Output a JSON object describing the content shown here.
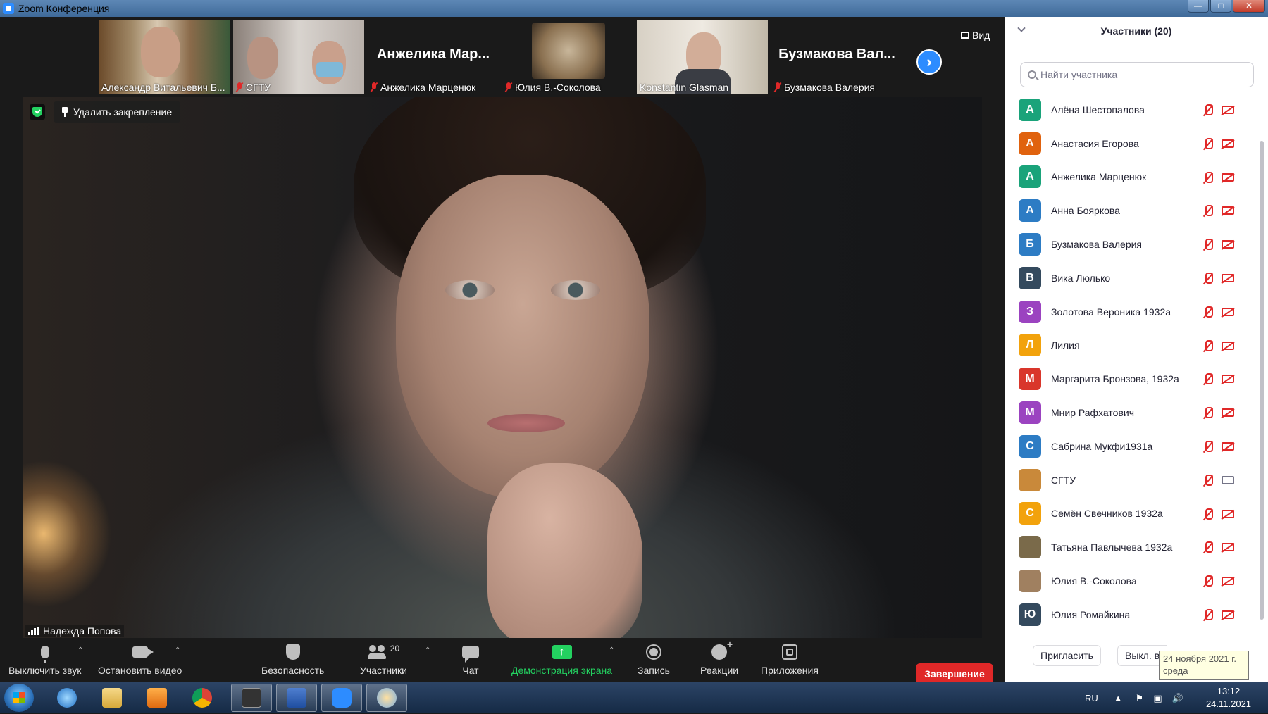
{
  "window": {
    "title": "Zoom Конференция"
  },
  "thumbnails": [
    {
      "name": "Александр Витальевич Б...",
      "muted": false
    },
    {
      "name": "СГТУ",
      "muted": true
    },
    {
      "big_name": "Анжелика Мар...",
      "name": "Анжелика Марценюк",
      "muted": true
    },
    {
      "name": "Юлия В.-Соколова",
      "muted": true
    },
    {
      "name": "Konstantin Glasman",
      "muted": false
    },
    {
      "big_name": "Бузмакова Вал...",
      "name": "Бузмакова Валерия",
      "muted": true
    }
  ],
  "view_label": "Вид",
  "main_video": {
    "unpin_label": "Удалить закрепление",
    "speaker_name": "Надежда Попова"
  },
  "toolbar": {
    "mute_label": "Выключить звук",
    "video_label": "Остановить видео",
    "security_label": "Безопасность",
    "participants_label": "Участники",
    "participants_count": "20",
    "chat_label": "Чат",
    "share_label": "Демонстрация экрана",
    "record_label": "Запись",
    "reactions_label": "Реакции",
    "apps_label": "Приложения",
    "end_label": "Завершение"
  },
  "panel": {
    "title": "Участники (20)",
    "search_placeholder": "Найти участника",
    "participants": [
      {
        "initial": "А",
        "name": "Алёна Шестопалова",
        "color": "#1aa37a",
        "video_on": false
      },
      {
        "initial": "А",
        "name": "Анастасия Егорова",
        "color": "#e0620e",
        "video_on": false
      },
      {
        "initial": "А",
        "name": "Анжелика Марценюк",
        "color": "#1aa37a",
        "video_on": false
      },
      {
        "initial": "А",
        "name": "Анна Бояркова",
        "color": "#2d7cc4",
        "video_on": false
      },
      {
        "initial": "Б",
        "name": "Бузмакова Валерия",
        "color": "#2d7cc4",
        "video_on": false
      },
      {
        "initial": "В",
        "name": "Вика Люлько",
        "color": "#344a5e",
        "video_on": false
      },
      {
        "initial": "З",
        "name": "Золотова Вероника 1932а",
        "color": "#9b43c0",
        "video_on": false
      },
      {
        "initial": "Л",
        "name": "Лилия",
        "color": "#f2a20c",
        "video_on": false
      },
      {
        "initial": "М",
        "name": "Маргарита Бронзова, 1932а",
        "color": "#d9362b",
        "video_on": false
      },
      {
        "initial": "М",
        "name": "Мнир Рафхатович",
        "color": "#9b43c0",
        "video_on": false
      },
      {
        "initial": "С",
        "name": "Сабрина Мукфи1931а",
        "color": "#2d7cc4",
        "video_on": false
      },
      {
        "initial": "",
        "name": "СГТУ",
        "color": "#c9893a",
        "video_on": true
      },
      {
        "initial": "С",
        "name": "Семён Свечников 1932а",
        "color": "#f2a20c",
        "video_on": false
      },
      {
        "initial": "",
        "name": "Татьяна Павлычева 1932а",
        "color": "#7a6a4a",
        "video_on": false
      },
      {
        "initial": "",
        "name": "Юлия В.-Соколова",
        "color": "#a08060",
        "video_on": false
      },
      {
        "initial": "Ю",
        "name": "Юлия Ромайкина",
        "color": "#344a5e",
        "video_on": false
      }
    ],
    "invite_label": "Пригласить",
    "mute_all_label": "Выкл. в"
  },
  "tooltip": {
    "line1": "24 ноября 2021 г.",
    "line2": "среда"
  },
  "taskbar": {
    "lang": "RU",
    "time": "13:12",
    "date": "24.11.2021"
  }
}
